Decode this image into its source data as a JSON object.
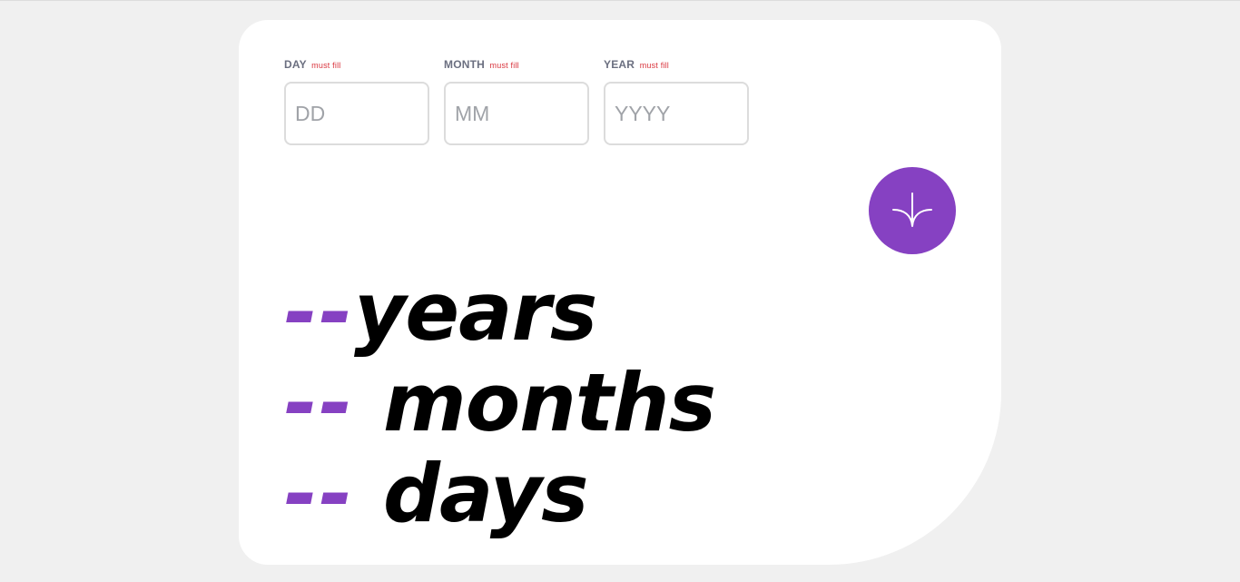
{
  "form": {
    "day": {
      "label": "DAY",
      "required": "must fill",
      "placeholder": "DD"
    },
    "month": {
      "label": "MONTH",
      "required": "must fill",
      "placeholder": "MM"
    },
    "year": {
      "label": "YEAR",
      "required": "must fill",
      "placeholder": "YYYY"
    }
  },
  "submit": {
    "icon": "arrow-down-icon",
    "color": "#8641c2"
  },
  "results": {
    "years": {
      "value": "--",
      "unit": "years"
    },
    "months": {
      "value": "--",
      "unit": "months"
    },
    "days": {
      "value": "--",
      "unit": "days"
    }
  },
  "colors": {
    "accent": "#8641c2",
    "error": "#d9343d",
    "background": "#f0f0f0",
    "card": "#ffffff"
  }
}
